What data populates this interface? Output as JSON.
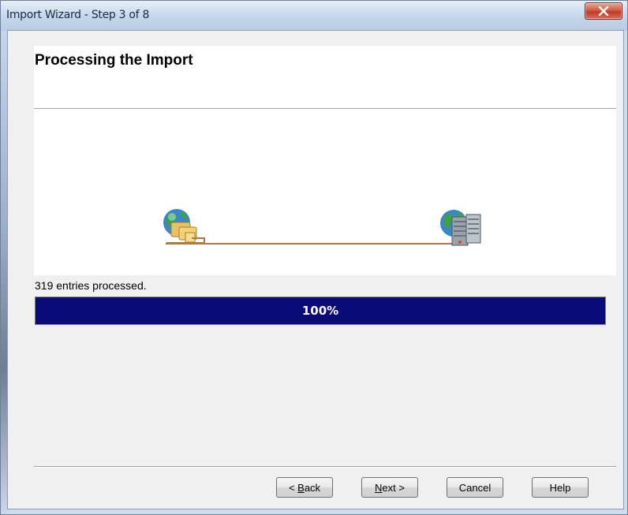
{
  "window": {
    "title": "Import Wizard - Step 3 of 8",
    "close_label": "close"
  },
  "page": {
    "title": "Processing the Import"
  },
  "graphic": {
    "left_icon": "globe-with-folders-icon",
    "right_icon": "globe-with-server-icon"
  },
  "status": {
    "text": "319 entries processed."
  },
  "progress": {
    "value": 100,
    "label": "100%",
    "fill_color": "#0a0a7a"
  },
  "buttons": {
    "back": {
      "pre": "< ",
      "key": "B",
      "post": "ack"
    },
    "next": {
      "key": "N",
      "post": "ext >"
    },
    "cancel": "Cancel",
    "help": "Help"
  }
}
